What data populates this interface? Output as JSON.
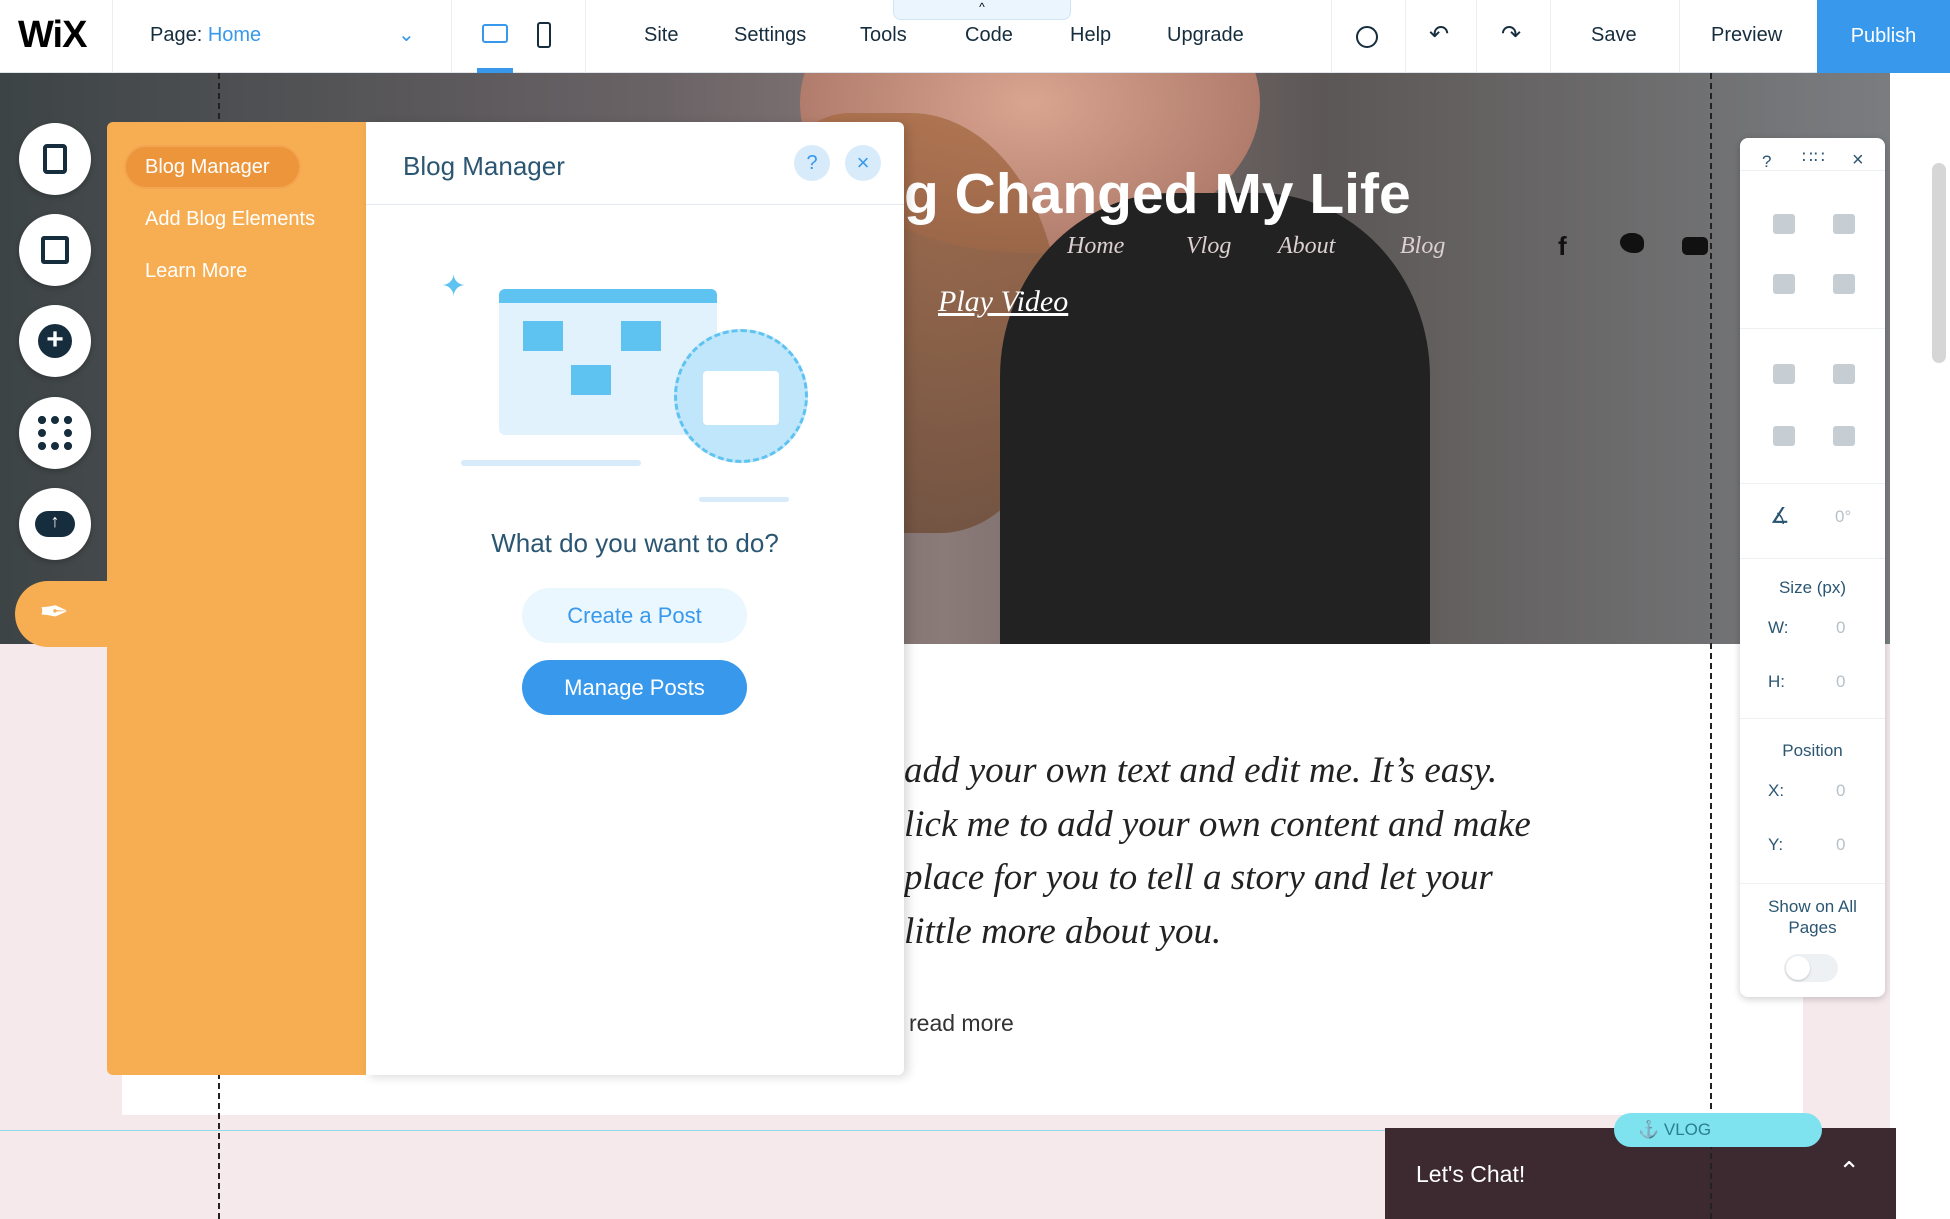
{
  "topbar": {
    "logo": "WiX",
    "page_label": "Page:",
    "page_value": "Home",
    "menu": [
      "Site",
      "Settings",
      "Tools",
      "Code",
      "Help",
      "Upgrade"
    ],
    "save": "Save",
    "preview": "Preview",
    "publish": "Publish",
    "accent": "#3899ec"
  },
  "site": {
    "title": "g Changed My Life",
    "nav": [
      "Home",
      "Vlog",
      "About",
      "Blog"
    ],
    "play": "Play Video",
    "body": [
      "add your own text and edit me. It’s easy.",
      "lick me to add your own content and make",
      "place for you to tell a story and let your",
      "little more about you."
    ],
    "read_more": "read more",
    "anchor": "VLOG",
    "chat": "Let's Chat!"
  },
  "blog_panel": {
    "nav": [
      "Blog Manager",
      "Add Blog Elements",
      "Learn More"
    ],
    "title": "Blog Manager",
    "help": "?",
    "question": "What do you want to do?",
    "create": "Create a Post",
    "manage": "Manage Posts",
    "orange": "#f7ad51"
  },
  "right_panel": {
    "help": "?",
    "rotation": "0°",
    "size_label": "Size (px)",
    "w_label": "W:",
    "w": "0",
    "h_label": "H:",
    "h": "0",
    "position_label": "Position",
    "x_label": "X:",
    "x": "0",
    "y_label": "Y:",
    "y": "0",
    "show_all": "Show on All Pages",
    "show_all_on": false
  }
}
